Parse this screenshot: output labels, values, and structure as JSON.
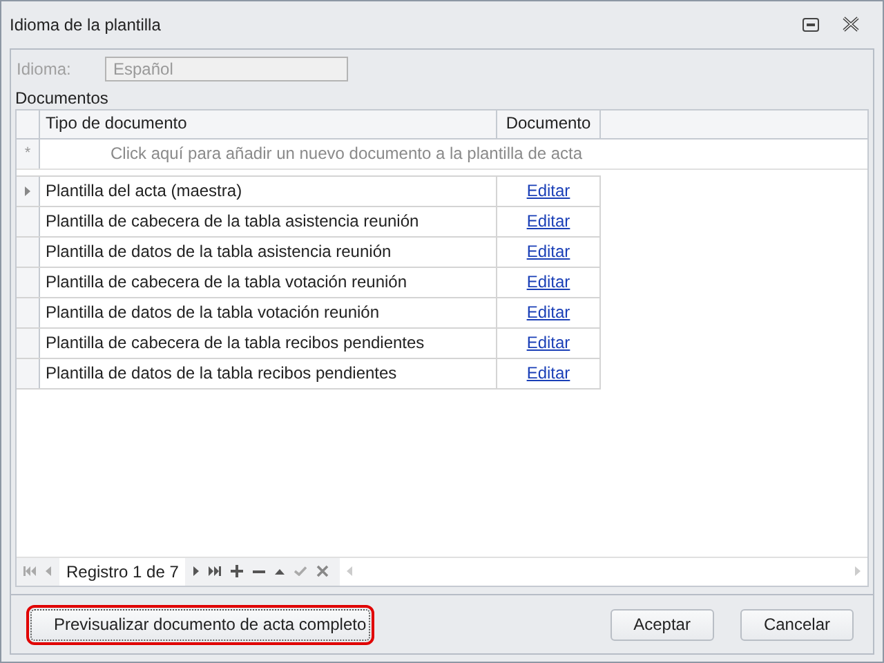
{
  "window": {
    "title": "Idioma de la plantilla"
  },
  "language_field": {
    "label": "Idioma:",
    "value": "Español",
    "disabled": true
  },
  "documents_label": "Documentos",
  "table": {
    "columns": [
      "Tipo de documento",
      "Documento"
    ],
    "new_row_marker": "*",
    "new_row_prompt": "Click aquí para añadir un nuevo documento a la plantilla de acta",
    "rows": [
      {
        "type": "Plantilla del acta (maestra)",
        "action": "Editar",
        "selected": true
      },
      {
        "type": "Plantilla de cabecera de la tabla asistencia reunión",
        "action": "Editar",
        "selected": false
      },
      {
        "type": "Plantilla de datos de la tabla asistencia reunión",
        "action": "Editar",
        "selected": false
      },
      {
        "type": "Plantilla de cabecera de la tabla votación reunión",
        "action": "Editar",
        "selected": false
      },
      {
        "type": "Plantilla de datos de la tabla votación reunión",
        "action": "Editar",
        "selected": false
      },
      {
        "type": "Plantilla de cabecera de la tabla recibos pendientes",
        "action": "Editar",
        "selected": false
      },
      {
        "type": "Plantilla de datos de la tabla recibos pendientes",
        "action": "Editar",
        "selected": false
      }
    ]
  },
  "navigator": {
    "record_text": "Registro 1 de 7"
  },
  "buttons": [
    {
      "label": "Previsualizar documento de acta completo",
      "kind": "left",
      "focused": true
    },
    {
      "label": "Aceptar",
      "kind": "right",
      "focused": false
    },
    {
      "label": "Cancelar",
      "kind": "right",
      "focused": false
    }
  ]
}
